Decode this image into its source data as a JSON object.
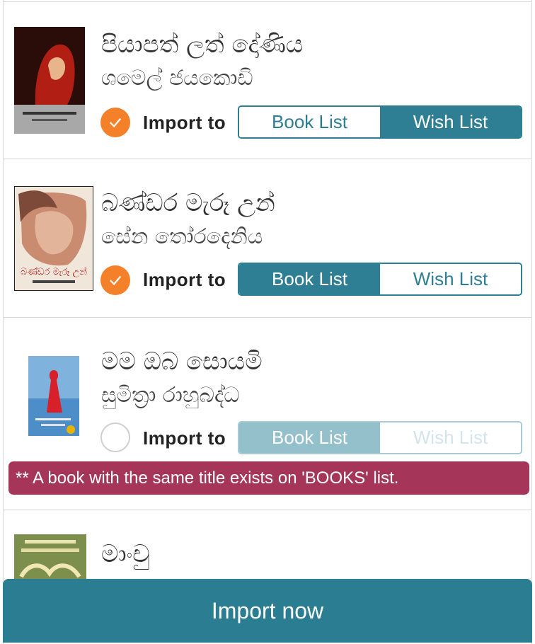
{
  "books": [
    {
      "title": "පියාපත් ලත් දෝණිය",
      "author": "ශමෙල් ජයකොඩි",
      "selected": true,
      "import_label": "Import to",
      "options": [
        "Book List",
        "Wish List"
      ],
      "active_option": "Wish List",
      "cover_icon": "book-cover-red-figure"
    },
    {
      "title": "බණ්ඩර මැරූ උන්",
      "author": "සේන තෝරදෙනිය",
      "selected": true,
      "import_label": "Import to",
      "options": [
        "Book List",
        "Wish List"
      ],
      "active_option": "Book List",
      "cover_icon": "book-cover-woman-face"
    },
    {
      "title": "මම ඔබ සොයමි",
      "author": "සුමිත්‍රා රාහුබද්ධ",
      "selected": false,
      "import_label": "Import to",
      "options": [
        "Book List",
        "Wish List"
      ],
      "active_option": "Book List",
      "warning": "** A book with the same title exists on 'BOOKS' list.",
      "cover_icon": "book-cover-blue-figure"
    },
    {
      "title": "මාංචු",
      "author": "",
      "cover_icon": "book-cover-green"
    }
  ],
  "import_now_label": "Import now",
  "colors": {
    "accent": "#2e7f94",
    "check": "#f4802a",
    "warning": "#a6355a"
  }
}
